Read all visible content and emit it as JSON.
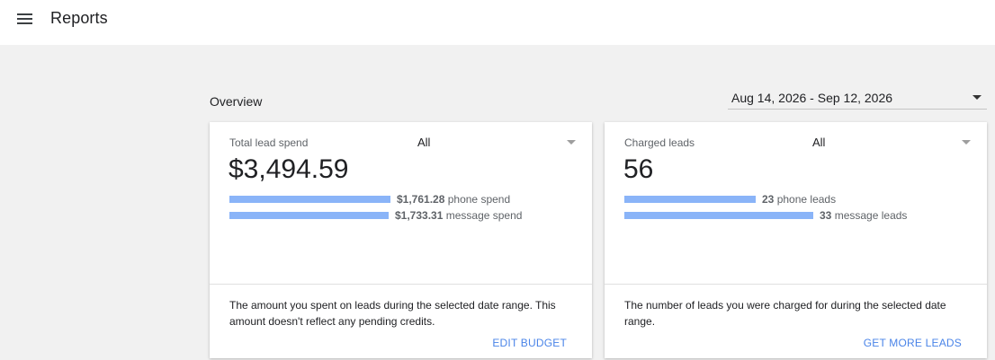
{
  "app": {
    "title": "Reports"
  },
  "overview": {
    "title": "Overview",
    "date_range": "Aug 14, 2026 - Sep 12, 2026"
  },
  "cards": [
    {
      "label": "Total lead spend",
      "filter": "All",
      "value": "$3,494.59",
      "rows": [
        {
          "amount": "$1,761.28",
          "text": "phone spend",
          "share": 0.504
        },
        {
          "amount": "$1,733.31",
          "text": "message spend",
          "share": 0.496
        }
      ],
      "description": "The amount you spent on leads during the selected date range. This amount doesn't reflect any pending credits.",
      "action": "EDIT BUDGET"
    },
    {
      "label": "Charged leads",
      "filter": "All",
      "value": "56",
      "rows": [
        {
          "amount": "23",
          "text": "phone leads",
          "share": 0.411
        },
        {
          "amount": "33",
          "text": "message leads",
          "share": 0.589
        }
      ],
      "description": "The number of leads you were charged for during the selected date range.",
      "action": "GET MORE LEADS"
    }
  ],
  "colors": {
    "bar": "#8ab4f8",
    "link": "#4a84e8",
    "background": "#f1f1f1"
  }
}
